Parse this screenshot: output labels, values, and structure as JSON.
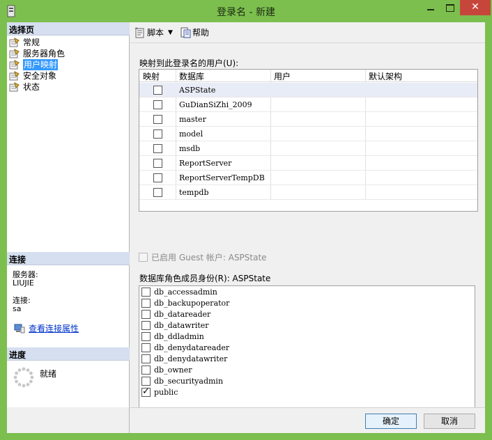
{
  "window": {
    "title": "登录名 - 新建",
    "close_glyph": "✕"
  },
  "left": {
    "pages_header": "选择页",
    "pages": [
      {
        "label": "常规",
        "selected": false
      },
      {
        "label": "服务器角色",
        "selected": false
      },
      {
        "label": "用户映射",
        "selected": true
      },
      {
        "label": "安全对象",
        "selected": false
      },
      {
        "label": "状态",
        "selected": false
      }
    ],
    "connection_header": "连接",
    "server_label": "服务器:",
    "server_value": "LIUJIE",
    "connection_label": "连接:",
    "connection_value": "sa",
    "view_props_link": "查看连接属性",
    "progress_header": "进度",
    "progress_status": "就绪"
  },
  "toolbar": {
    "script_label": "脚本",
    "help_label": "帮助"
  },
  "mapping": {
    "label": "映射到此登录名的用户(U):",
    "columns": [
      "映射",
      "数据库",
      "用户",
      "默认架构"
    ],
    "rows": [
      {
        "db": "ASPState",
        "checked": false
      },
      {
        "db": "GuDianSiZhi_2009",
        "checked": false
      },
      {
        "db": "master",
        "checked": false
      },
      {
        "db": "model",
        "checked": false
      },
      {
        "db": "msdb",
        "checked": false
      },
      {
        "db": "ReportServer",
        "checked": false
      },
      {
        "db": "ReportServerTempDB",
        "checked": false
      },
      {
        "db": "tempdb",
        "checked": false
      }
    ]
  },
  "guest": {
    "label": "已启用 Guest 帐户: ASPState"
  },
  "roles": {
    "label": "数据库角色成员身份(R): ASPState",
    "items": [
      {
        "name": "db_accessadmin",
        "checked": false
      },
      {
        "name": "db_backupoperator",
        "checked": false
      },
      {
        "name": "db_datareader",
        "checked": false
      },
      {
        "name": "db_datawriter",
        "checked": false
      },
      {
        "name": "db_ddladmin",
        "checked": false
      },
      {
        "name": "db_denydatareader",
        "checked": false
      },
      {
        "name": "db_denydatawriter",
        "checked": false
      },
      {
        "name": "db_owner",
        "checked": false
      },
      {
        "name": "db_securityadmin",
        "checked": false
      },
      {
        "name": "public",
        "checked": true
      }
    ]
  },
  "buttons": {
    "ok": "确定",
    "cancel": "取消"
  },
  "colors": {
    "frame": "#7cbf4e",
    "close": "#c7463b",
    "selection": "#3399ff",
    "section_header": "#d5dfef"
  }
}
